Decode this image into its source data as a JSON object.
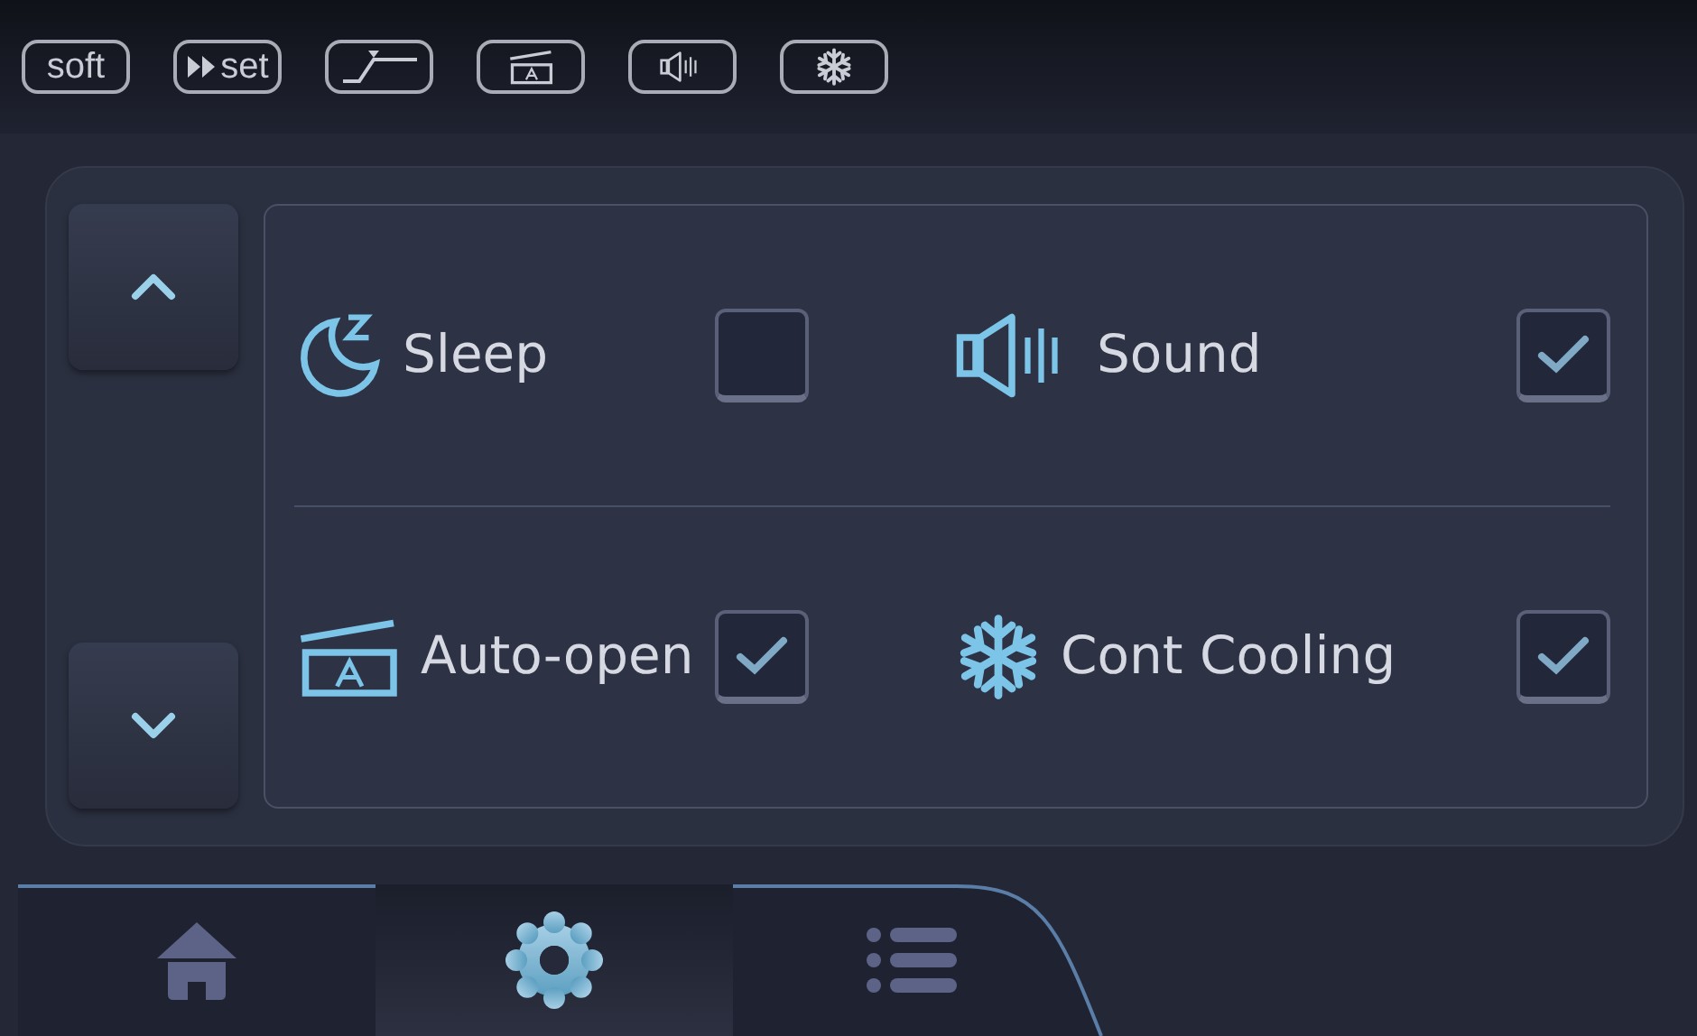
{
  "status_icons": [
    {
      "kind": "text",
      "label": "soft"
    },
    {
      "kind": "fast-forward",
      "label": "set"
    },
    {
      "kind": "ramp"
    },
    {
      "kind": "auto-open"
    },
    {
      "kind": "sound"
    },
    {
      "kind": "cooling"
    }
  ],
  "settings": [
    {
      "kind": "sleep",
      "label": "Sleep",
      "checked": false
    },
    {
      "kind": "sound",
      "label": "Sound",
      "checked": true
    },
    {
      "kind": "auto-open",
      "label": "Auto-open",
      "checked": true
    },
    {
      "kind": "cooling",
      "label": "Cont Cooling",
      "checked": true
    }
  ],
  "nav_tabs": [
    {
      "kind": "home",
      "selected": false
    },
    {
      "kind": "settings",
      "selected": true
    },
    {
      "kind": "list",
      "selected": false
    }
  ]
}
